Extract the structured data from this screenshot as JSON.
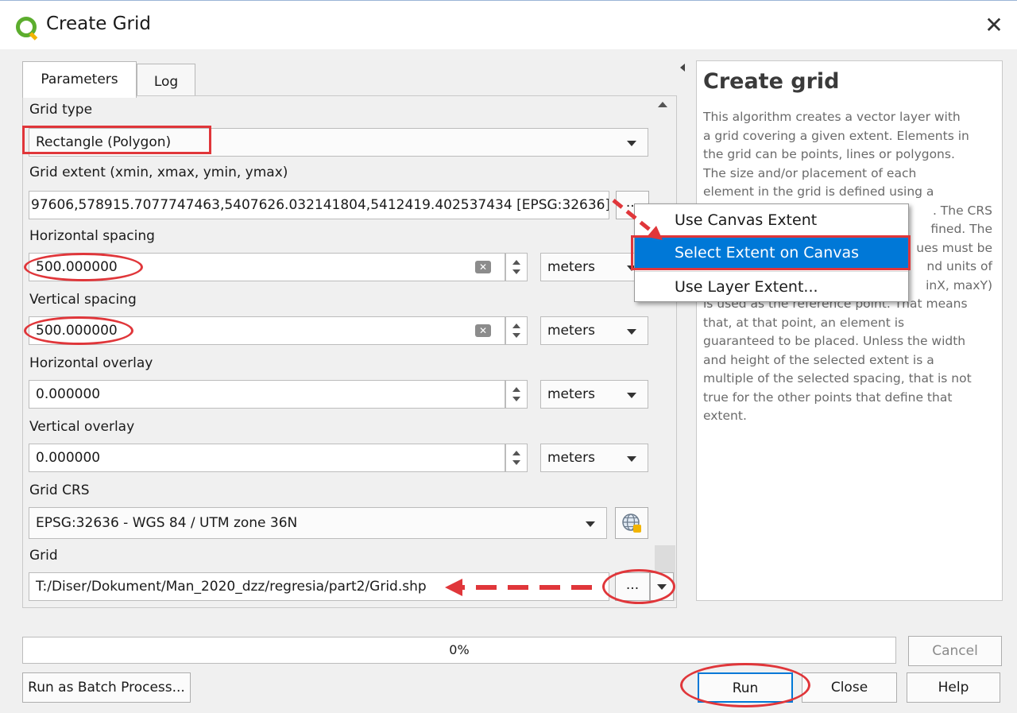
{
  "window": {
    "title": "Create Grid",
    "close_glyph": "✕"
  },
  "tabs": [
    {
      "label": "Parameters"
    },
    {
      "label": "Log"
    }
  ],
  "params": {
    "grid_type": {
      "label": "Grid type",
      "value": "Rectangle (Polygon)"
    },
    "grid_extent": {
      "label": "Grid extent (xmin, xmax, ymin, ymax)",
      "value": "97606,578915.7077747463,5407626.032141804,5412419.402537434 [EPSG:32636]",
      "button_label": "..."
    },
    "h_spacing": {
      "label": "Horizontal spacing",
      "value": "500.000000",
      "unit": "meters"
    },
    "v_spacing": {
      "label": "Vertical spacing",
      "value": "500.000000",
      "unit": "meters"
    },
    "h_overlay": {
      "label": "Horizontal overlay",
      "value": "0.000000",
      "unit": "meters"
    },
    "v_overlay": {
      "label": "Vertical overlay",
      "value": "0.000000",
      "unit": "meters"
    },
    "grid_crs": {
      "label": "Grid CRS",
      "value": "EPSG:32636 - WGS 84 / UTM zone 36N"
    },
    "grid_output": {
      "label": "Grid",
      "value": "T:/Diser/Dokument/Man_2020_dzz/regresia/part2/Grid.shp",
      "button_label": "..."
    }
  },
  "extent_menu": {
    "items": [
      "Use Canvas Extent",
      "Select Extent on Canvas",
      "Use Layer Extent..."
    ],
    "selected_index": 1
  },
  "help": {
    "title": "Create grid",
    "lines": [
      "This algorithm creates a vector layer with",
      "a grid covering a given extent. Elements in",
      "the grid can be points, lines or polygons.",
      "The size and/or placement of each",
      "element in the grid is defined using a",
      ". The CRS",
      "fined. The",
      "ues must be",
      "nd units of",
      "inX, maxY)",
      "is used as the reference point. That means",
      "that, at that point, an element is",
      "guaranteed to be placed. Unless the width",
      "and height of the selected extent is a",
      "multiple of the selected spacing, that is not",
      "true for the other points that define that",
      "extent."
    ]
  },
  "progress": {
    "text": "0%",
    "value": 0
  },
  "buttons": {
    "cancel": "Cancel",
    "batch": "Run as Batch Process...",
    "run": "Run",
    "close": "Close",
    "help": "Help"
  },
  "colors": {
    "annotation_red": "#e0363a",
    "menu_highlight": "#0078d7",
    "qgis_green": "#5cad2e"
  },
  "icons": {
    "crs_selector": "globe-icon",
    "clear": "clear-icon"
  }
}
